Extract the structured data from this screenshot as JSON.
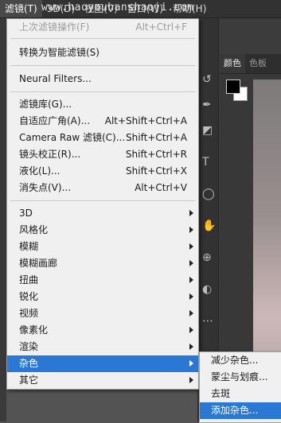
{
  "menubar": {
    "items": [
      {
        "label": "滤镜(T)",
        "active": true
      },
      {
        "label": "3D(D)"
      },
      {
        "label": "视图(V)"
      },
      {
        "label": "窗口(W)"
      },
      {
        "label": "帮助(H)"
      }
    ],
    "watermark": "www.haoyouhanshaoji.com"
  },
  "panel": {
    "tabs": [
      "颜色",
      "色板"
    ],
    "foreground_color": "#000000",
    "background_color": "#ffffff"
  },
  "filter_menu": {
    "last_filter": {
      "label": "上次滤镜操作(F)",
      "shortcut": "Alt+Ctrl+F"
    },
    "convert_smart": {
      "label": "转换为智能滤镜(S)"
    },
    "neural": {
      "label": "Neural Filters..."
    },
    "gallery": {
      "label": "滤镜库(G)..."
    },
    "adaptive_wide": {
      "label": "自适应广角(A)...",
      "shortcut": "Alt+Shift+Ctrl+A"
    },
    "camera_raw": {
      "label": "Camera Raw 滤镜(C)...",
      "shortcut": "Shift+Ctrl+A"
    },
    "lens_correction": {
      "label": "镜头校正(R)...",
      "shortcut": "Shift+Ctrl+R"
    },
    "liquify": {
      "label": "液化(L)...",
      "shortcut": "Shift+Ctrl+X"
    },
    "vanishing_point": {
      "label": "消失点(V)...",
      "shortcut": "Alt+Ctrl+V"
    },
    "submenus": [
      {
        "label": "3D"
      },
      {
        "label": "风格化"
      },
      {
        "label": "模糊"
      },
      {
        "label": "模糊画廊"
      },
      {
        "label": "扭曲"
      },
      {
        "label": "锐化"
      },
      {
        "label": "视频"
      },
      {
        "label": "像素化"
      },
      {
        "label": "渲染"
      },
      {
        "label": "杂色"
      },
      {
        "label": "其它"
      }
    ]
  },
  "noise_submenu": {
    "items": [
      {
        "label": "减少杂色..."
      },
      {
        "label": "蒙尘与划痕..."
      },
      {
        "label": "去斑"
      },
      {
        "label": "添加杂色..."
      }
    ]
  },
  "colors": {
    "highlight": "#2b78d4",
    "menu_bg": "#f0f0f0",
    "app_bg": "#535353"
  }
}
